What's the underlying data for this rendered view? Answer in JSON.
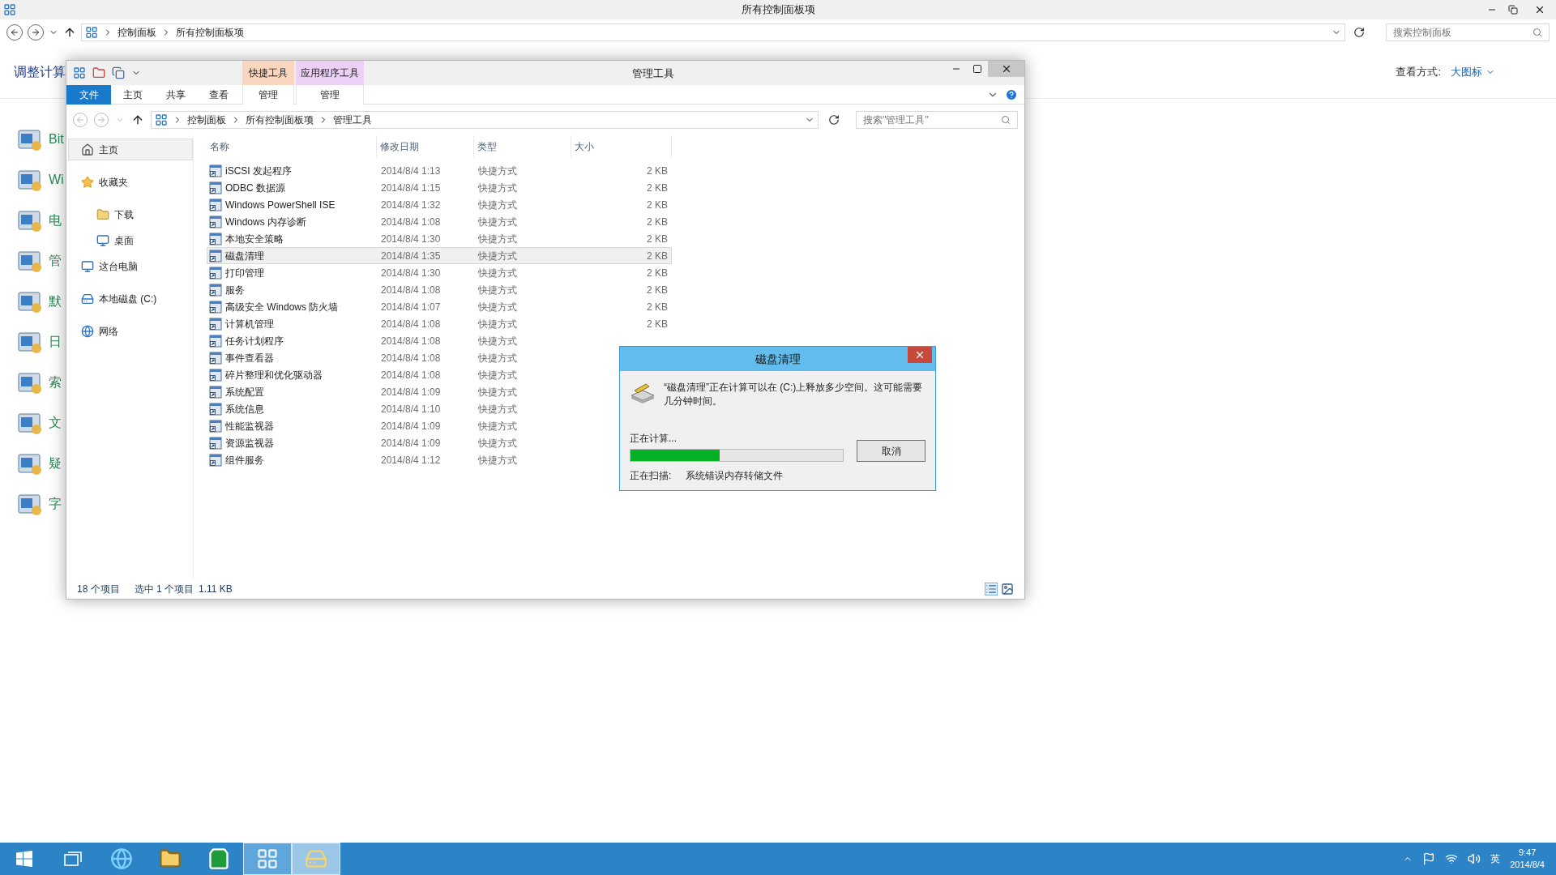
{
  "control_panel": {
    "title": "所有控制面板项",
    "breadcrumb": [
      "控制面板",
      "所有控制面板项"
    ],
    "search_placeholder": "搜索控制面板",
    "heading": "调整计算",
    "view_label": "查看方式:",
    "view_value": "大图标",
    "items": [
      "Bit",
      "Wi",
      "电",
      "管",
      "默",
      "日",
      "索",
      "文",
      "疑",
      "字"
    ]
  },
  "explorer": {
    "title": "管理工具",
    "context_tabs": [
      {
        "label": "快捷工具",
        "color": "#fbd6bf"
      },
      {
        "label": "应用程序工具",
        "color": "#ecd0f5"
      }
    ],
    "ribbon_tabs": [
      {
        "label": "文件",
        "kind": "file"
      },
      {
        "label": "主页",
        "kind": "plain"
      },
      {
        "label": "共享",
        "kind": "plain"
      },
      {
        "label": "查看",
        "kind": "plain"
      },
      {
        "label": "管理",
        "kind": "context"
      },
      {
        "label": "管理",
        "kind": "context"
      }
    ],
    "breadcrumb": [
      "控制面板",
      "所有控制面板项",
      "管理工具"
    ],
    "search_placeholder": "搜索\"管理工具\"",
    "nav": [
      {
        "label": "主页",
        "kind": "home",
        "selected": true
      },
      {
        "label": "收藏夹",
        "kind": "star",
        "selected": false,
        "children": [
          {
            "label": "下载",
            "kind": "download",
            "selected": false
          },
          {
            "label": "桌面",
            "kind": "desktop",
            "selected": false
          }
        ]
      },
      {
        "label": "这台电脑",
        "kind": "computer",
        "selected": false
      },
      {
        "label": "本地磁盘 (C:)",
        "kind": "drive",
        "selected": false
      },
      {
        "label": "网络",
        "kind": "network",
        "selected": false
      }
    ],
    "columns": [
      "名称",
      "修改日期",
      "类型",
      "大小"
    ],
    "rows": [
      {
        "name": "iSCSI 发起程序",
        "date": "2014/8/4 1:13",
        "type": "快捷方式",
        "size": "2 KB",
        "selected": false
      },
      {
        "name": "ODBC 数据源",
        "date": "2014/8/4 1:15",
        "type": "快捷方式",
        "size": "2 KB",
        "selected": false
      },
      {
        "name": "Windows PowerShell ISE",
        "date": "2014/8/4 1:32",
        "type": "快捷方式",
        "size": "2 KB",
        "selected": false
      },
      {
        "name": "Windows 内存诊断",
        "date": "2014/8/4 1:08",
        "type": "快捷方式",
        "size": "2 KB",
        "selected": false
      },
      {
        "name": "本地安全策略",
        "date": "2014/8/4 1:30",
        "type": "快捷方式",
        "size": "2 KB",
        "selected": false
      },
      {
        "name": "磁盘清理",
        "date": "2014/8/4 1:35",
        "type": "快捷方式",
        "size": "2 KB",
        "selected": true
      },
      {
        "name": "打印管理",
        "date": "2014/8/4 1:30",
        "type": "快捷方式",
        "size": "2 KB",
        "selected": false
      },
      {
        "name": "服务",
        "date": "2014/8/4 1:08",
        "type": "快捷方式",
        "size": "2 KB",
        "selected": false
      },
      {
        "name": "高级安全 Windows 防火墙",
        "date": "2014/8/4 1:07",
        "type": "快捷方式",
        "size": "2 KB",
        "selected": false
      },
      {
        "name": "计算机管理",
        "date": "2014/8/4 1:08",
        "type": "快捷方式",
        "size": "2 KB",
        "selected": false
      },
      {
        "name": "任务计划程序",
        "date": "2014/8/4 1:08",
        "type": "快捷方式",
        "selected": false
      },
      {
        "name": "事件查看器",
        "date": "2014/8/4 1:08",
        "type": "快捷方式",
        "selected": false
      },
      {
        "name": "碎片整理和优化驱动器",
        "date": "2014/8/4 1:08",
        "type": "快捷方式",
        "selected": false
      },
      {
        "name": "系统配置",
        "date": "2014/8/4 1:09",
        "type": "快捷方式",
        "selected": false
      },
      {
        "name": "系统信息",
        "date": "2014/8/4 1:10",
        "type": "快捷方式",
        "selected": false
      },
      {
        "name": "性能监视器",
        "date": "2014/8/4 1:09",
        "type": "快捷方式",
        "selected": false
      },
      {
        "name": "资源监视器",
        "date": "2014/8/4 1:09",
        "type": "快捷方式",
        "selected": false
      },
      {
        "name": "组件服务",
        "date": "2014/8/4 1:12",
        "type": "快捷方式",
        "selected": false
      }
    ],
    "status": [
      "18 个项目",
      "选中 1 个项目",
      "1.11 KB"
    ]
  },
  "dialog": {
    "title": "磁盘清理",
    "message": "“磁盘清理”正在计算可以在 (C:)上释放多少空间。这可能需要几分钟时间。",
    "progress_label": "正在计算...",
    "level": 0.42,
    "cancel": "取消",
    "scan_label": "正在扫描:",
    "scan_value": "系统错误内存转储文件"
  },
  "taskbar": {
    "apps": [
      {
        "kind": "start",
        "selected": false,
        "running": false
      },
      {
        "kind": "taskview",
        "selected": false,
        "running": false
      },
      {
        "kind": "browser",
        "selected": false,
        "running": false
      },
      {
        "kind": "explorer",
        "selected": false,
        "running": false
      },
      {
        "kind": "store",
        "selected": false,
        "running": false
      },
      {
        "kind": "control",
        "selected": false,
        "running": true
      },
      {
        "kind": "cleanup",
        "selected": true,
        "running": true
      }
    ],
    "ime": "英",
    "time": "9:47",
    "date": "2014/8/4"
  }
}
